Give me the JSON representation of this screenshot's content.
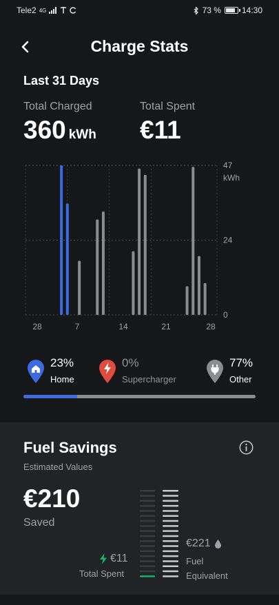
{
  "status_bar": {
    "carrier": "Tele2",
    "network": "4G",
    "battery": "73 %",
    "time": "14:30"
  },
  "header": {
    "title": "Charge Stats"
  },
  "period": "Last 31 Days",
  "totals": {
    "charged_label": "Total Charged",
    "charged_value": "360",
    "charged_unit": "kWh",
    "spent_label": "Total Spent",
    "spent_value": "€11"
  },
  "chart_data": {
    "type": "bar",
    "y_unit": "kWh",
    "ylim": [
      0,
      47
    ],
    "y_ticks": [
      "47",
      "24",
      "0"
    ],
    "x_ticks": [
      "28",
      "7",
      "14",
      "21",
      "28"
    ],
    "colors": {
      "home": "#3e6ae1",
      "other": "#8a8c90"
    },
    "bars": [
      {
        "day_index": 6,
        "value": 47,
        "source": "home"
      },
      {
        "day_index": 7,
        "value": 35,
        "source": "home"
      },
      {
        "day_index": 9,
        "value": 17,
        "source": "other"
      },
      {
        "day_index": 12,
        "value": 30,
        "source": "other"
      },
      {
        "day_index": 13,
        "value": 32.5,
        "source": "other"
      },
      {
        "day_index": 18,
        "value": 20,
        "source": "other"
      },
      {
        "day_index": 19,
        "value": 46,
        "source": "other"
      },
      {
        "day_index": 20,
        "value": 44,
        "source": "other"
      },
      {
        "day_index": 27,
        "value": 9,
        "source": "other"
      },
      {
        "day_index": 28,
        "value": 46.5,
        "source": "other"
      },
      {
        "day_index": 29,
        "value": 18.5,
        "source": "other"
      },
      {
        "day_index": 30,
        "value": 10,
        "source": "other"
      }
    ],
    "day_count": 33
  },
  "legend": {
    "home": {
      "percent": "23%",
      "label": "Home",
      "color": "#3e6ae1",
      "icon": "home-pin-icon"
    },
    "supercharger": {
      "percent": "0%",
      "label": "Supercharger",
      "color": "#e04a3f",
      "icon": "lightning-pin-icon"
    },
    "other": {
      "percent": "77%",
      "label": "Other",
      "color": "#8a8c90",
      "icon": "plug-pin-icon"
    }
  },
  "share_bar": {
    "home": 0.23,
    "supercharger": 0.0,
    "other": 0.77
  },
  "fuel_savings": {
    "title": "Fuel Savings",
    "subtitle": "Estimated Values",
    "saved_value": "€210",
    "saved_label": "Saved",
    "spent_amount": "€11",
    "spent_label": "Total Spent",
    "fuel_amount": "€221",
    "fuel_label_1": "Fuel",
    "fuel_label_2": "Equivalent",
    "spent_level": 0.05,
    "fuel_level": 1.0
  }
}
